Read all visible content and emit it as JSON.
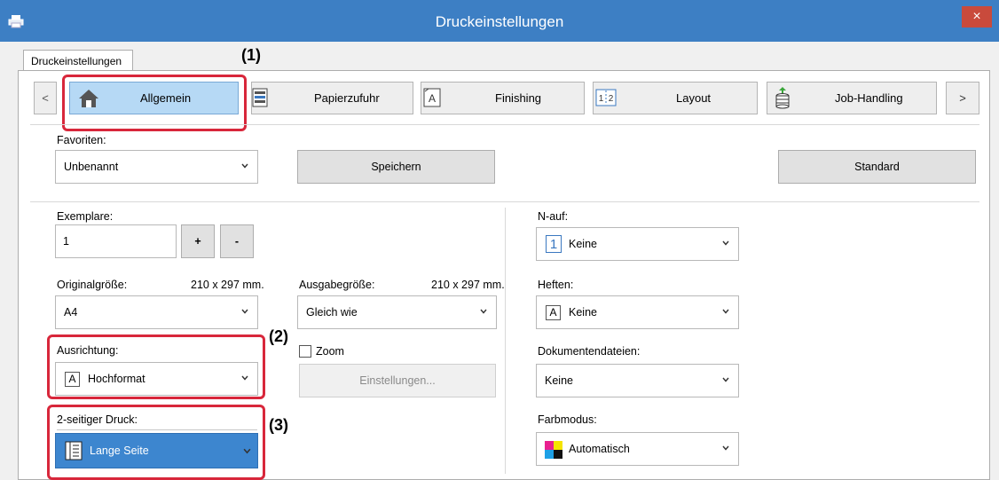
{
  "window": {
    "title": "Druckeinstellungen",
    "close_glyph": "×"
  },
  "tabs": [
    {
      "label": "Druckeinstellungen"
    }
  ],
  "nav": {
    "prev": "<",
    "next": ">",
    "items": [
      {
        "label": "Allgemein",
        "icon": "home-icon"
      },
      {
        "label": "Papierzufuhr",
        "icon": "paper-tray-icon"
      },
      {
        "label": "Finishing",
        "icon": "finishing-icon"
      },
      {
        "label": "Layout",
        "icon": "layout-icon"
      },
      {
        "label": "Job-Handling",
        "icon": "job-handling-icon"
      }
    ]
  },
  "favorites": {
    "label": "Favoriten:",
    "value": "Unbenannt",
    "save_label": "Speichern",
    "default_label": "Standard"
  },
  "copies": {
    "label": "Exemplare:",
    "value": "1",
    "plus": "+",
    "minus": "-"
  },
  "original_size": {
    "label": "Originalgröße:",
    "dims": "210 x 297 mm.",
    "value": "A4"
  },
  "output_size": {
    "label": "Ausgabegröße:",
    "dims": "210 x 297 mm.",
    "value": "Gleich wie"
  },
  "orientation": {
    "label": "Ausrichtung:",
    "icon_letter": "A",
    "value": "Hochformat"
  },
  "zoom": {
    "label": "Zoom",
    "checked": false,
    "settings_label": "Einstellungen..."
  },
  "duplex": {
    "label": "2-seitiger Druck:",
    "value": "Lange Seite"
  },
  "n_up": {
    "label": "N-auf:",
    "icon_number": "1",
    "value": "Keine"
  },
  "staple": {
    "label": "Heften:",
    "icon_letter": "A",
    "value": "Keine"
  },
  "doc_filing": {
    "label": "Dokumentendateien:",
    "value": "Keine"
  },
  "color_mode": {
    "label": "Farbmodus:",
    "value": "Automatisch"
  },
  "markers": {
    "m1": "(1)",
    "m2": "(2)",
    "m3": "(3)"
  },
  "colors": {
    "titlebar": "#3d7fc4",
    "highlight": "#d8273b",
    "selected": "#3d86cf",
    "close": "#c94a3c"
  }
}
